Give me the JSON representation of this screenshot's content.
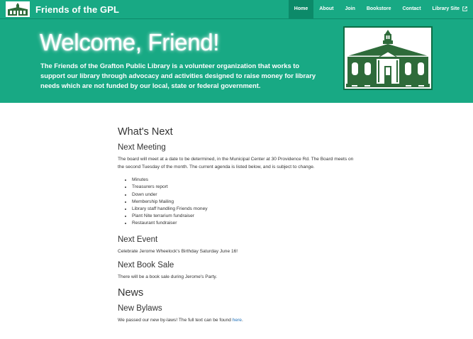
{
  "navbar": {
    "brand": "Friends of the GPL",
    "items": [
      {
        "label": "Home",
        "active": true
      },
      {
        "label": "About",
        "active": false
      },
      {
        "label": "Join",
        "active": false
      },
      {
        "label": "Bookstore",
        "active": false
      },
      {
        "label": "Contact",
        "active": false
      },
      {
        "label": "Library Site",
        "active": false,
        "icon": "external-link-icon"
      }
    ]
  },
  "hero": {
    "title": "Welcome, Friend!",
    "text": "The Friends of the Grafton Public Library is a volunteer organization that works to support our library through advocacy and activities designed to raise money for library needs which are not funded by our local, state or federal government.",
    "image_icon": "library-building-illustration"
  },
  "content": {
    "whats_next": "What's Next",
    "next_meeting": {
      "heading": "Next Meeting",
      "text": "The board will meet at a date to be determined, in the Municipal Center at 30 Providence Rd. The Board meets on the second Tuesday of the month. The current agenda is listed below, and is subject to change.",
      "agenda": [
        "Minutes",
        "Treasurers report",
        "Down under",
        "Membership Mailing",
        "Library staff handling Friends money",
        "Plant Nite terrarium fundraiser",
        "Restaurant fundraiser"
      ]
    },
    "next_event": {
      "heading": "Next Event",
      "text": "Celebrate Jerome Wheelock's Birthday Saturday June 16!"
    },
    "next_book_sale": {
      "heading": "Next Book Sale",
      "text": "There will be a book sale during Jerome's Party."
    },
    "news": "News",
    "new_bylaws": {
      "heading": "New Bylaws",
      "text": "We passed our new by-laws! The full text can be found ",
      "link": "here",
      "tail": "."
    }
  },
  "colors": {
    "brand_green": "#18a984",
    "active_nav": "#0c8a69",
    "building_green": "#2e6b3a",
    "link_blue": "#1e6fb8"
  }
}
